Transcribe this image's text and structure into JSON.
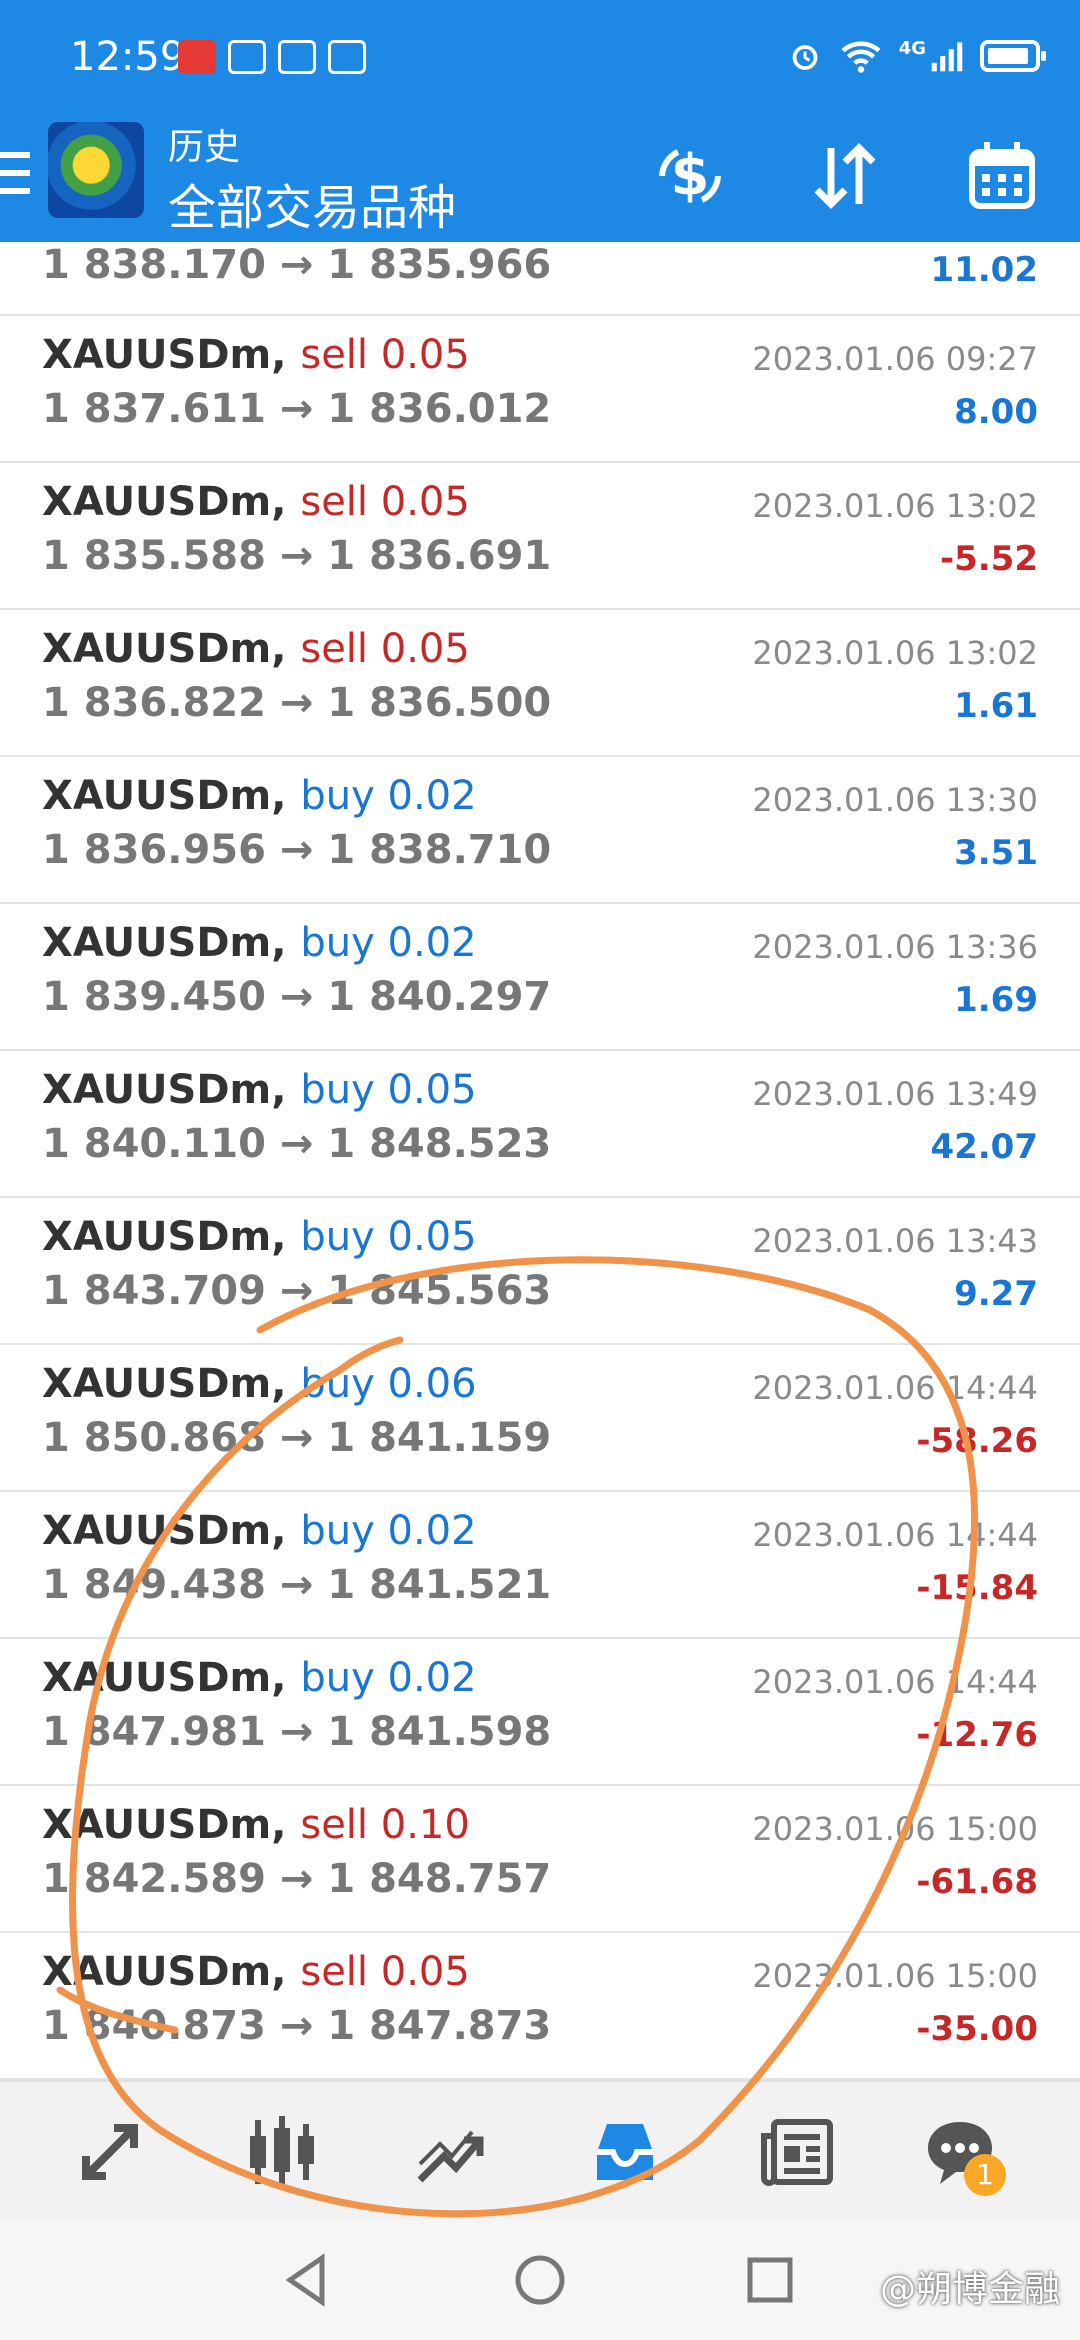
{
  "status_bar": {
    "time": "12:59",
    "network": "4G"
  },
  "header": {
    "title": "历史",
    "subtitle": "全部交易品种",
    "icons": [
      "menu-icon",
      "app-logo",
      "currency-exchange-icon",
      "sort-icon",
      "calendar-icon"
    ]
  },
  "partial_row": {
    "prices": "1 838.170 → 1 835.966",
    "profit": "11.02"
  },
  "trades": [
    {
      "symbol": "XAUUSDm,",
      "side": "sell 0.05",
      "type": "sell",
      "prices": "1 837.611 → 1 836.012",
      "date": "2023.01.06 09:27",
      "profit": "8.00",
      "sign": "pos"
    },
    {
      "symbol": "XAUUSDm,",
      "side": "sell 0.05",
      "type": "sell",
      "prices": "1 835.588 → 1 836.691",
      "date": "2023.01.06 13:02",
      "profit": "-5.52",
      "sign": "neg"
    },
    {
      "symbol": "XAUUSDm,",
      "side": "sell 0.05",
      "type": "sell",
      "prices": "1 836.822 → 1 836.500",
      "date": "2023.01.06 13:02",
      "profit": "1.61",
      "sign": "pos"
    },
    {
      "symbol": "XAUUSDm,",
      "side": "buy 0.02",
      "type": "buy",
      "prices": "1 836.956 → 1 838.710",
      "date": "2023.01.06 13:30",
      "profit": "3.51",
      "sign": "pos"
    },
    {
      "symbol": "XAUUSDm,",
      "side": "buy 0.02",
      "type": "buy",
      "prices": "1 839.450 → 1 840.297",
      "date": "2023.01.06 13:36",
      "profit": "1.69",
      "sign": "pos"
    },
    {
      "symbol": "XAUUSDm,",
      "side": "buy 0.05",
      "type": "buy",
      "prices": "1 840.110 → 1 848.523",
      "date": "2023.01.06 13:49",
      "profit": "42.07",
      "sign": "pos"
    },
    {
      "symbol": "XAUUSDm,",
      "side": "buy 0.05",
      "type": "buy",
      "prices": "1 843.709 → 1 845.563",
      "date": "2023.01.06 13:43",
      "profit": "9.27",
      "sign": "pos"
    },
    {
      "symbol": "XAUUSDm,",
      "side": "buy 0.06",
      "type": "buy",
      "prices": "1 850.868 → 1 841.159",
      "date": "2023.01.06 14:44",
      "profit": "-58.26",
      "sign": "neg"
    },
    {
      "symbol": "XAUUSDm,",
      "side": "buy 0.02",
      "type": "buy",
      "prices": "1 849.438 → 1 841.521",
      "date": "2023.01.06 14:44",
      "profit": "-15.84",
      "sign": "neg"
    },
    {
      "symbol": "XAUUSDm,",
      "side": "buy 0.02",
      "type": "buy",
      "prices": "1 847.981 → 1 841.598",
      "date": "2023.01.06 14:44",
      "profit": "-12.76",
      "sign": "neg"
    },
    {
      "symbol": "XAUUSDm,",
      "side": "sell 0.10",
      "type": "sell",
      "prices": "1 842.589 → 1 848.757",
      "date": "2023.01.06 15:00",
      "profit": "-61.68",
      "sign": "neg"
    },
    {
      "symbol": "XAUUSDm,",
      "side": "sell 0.05",
      "type": "sell",
      "prices": "1 840.873 → 1 847.873",
      "date": "2023.01.06 15:00",
      "profit": "-35.00",
      "sign": "neg"
    }
  ],
  "bottom_nav": {
    "items": [
      "quotes-icon",
      "chart-icon",
      "trade-icon",
      "history-icon",
      "news-icon",
      "messages-icon"
    ],
    "active": "history-icon",
    "messages_badge": "1"
  },
  "watermark": "@朔博金融",
  "colors": {
    "brand": "#1e88e5",
    "sell": "#c62828",
    "buy": "#1976d2",
    "annotation": "#f0924a"
  }
}
